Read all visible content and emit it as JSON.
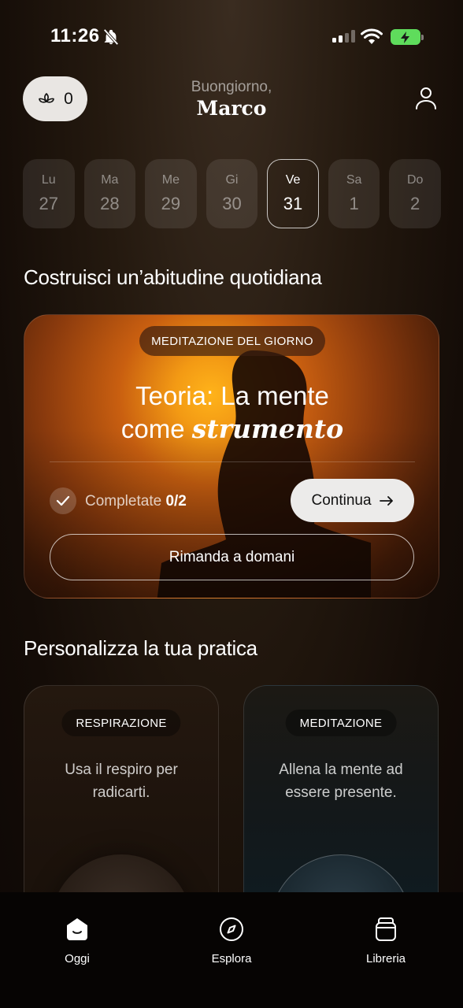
{
  "status_bar": {
    "time": "11:26"
  },
  "header": {
    "lotus_count": "0",
    "greeting": "Buongiorno,",
    "user_name": "Marco"
  },
  "week": [
    {
      "day": "Lu",
      "date": "27",
      "active": false
    },
    {
      "day": "Ma",
      "date": "28",
      "active": false
    },
    {
      "day": "Me",
      "date": "29",
      "active": false
    },
    {
      "day": "Gi",
      "date": "30",
      "active": false
    },
    {
      "day": "Ve",
      "date": "31",
      "active": true
    },
    {
      "day": "Sa",
      "date": "1",
      "active": false
    },
    {
      "day": "Do",
      "date": "2",
      "active": false
    }
  ],
  "habit_section": {
    "title": "Costruisci un’abitudine quotidiana"
  },
  "daily_meditation": {
    "tag": "MEDITAZIONE DEL GIORNO",
    "title_line1": "Teoria: La mente",
    "title_line2_plain": "come ",
    "title_line2_italic": "strumento",
    "completed_label": "Completate ",
    "completed_value": "0/2",
    "continue_label": "Continua",
    "postpone_label": "Rimanda a domani"
  },
  "practice_section": {
    "title": "Personalizza la tua pratica"
  },
  "practice_cards": [
    {
      "tag": "RESPIRAZIONE",
      "text": "Usa il respiro per radicarti."
    },
    {
      "tag": "MEDITAZIONE",
      "text": "Allena la mente ad essere presente."
    }
  ],
  "nav": [
    {
      "label": "Oggi",
      "icon": "home-icon"
    },
    {
      "label": "Esplora",
      "icon": "compass-icon"
    },
    {
      "label": "Libreria",
      "icon": "library-icon"
    }
  ],
  "colors": {
    "battery": "#5fdc5c",
    "accent_orange": "#f39a14",
    "pill_bg": "#e9e6e3"
  }
}
